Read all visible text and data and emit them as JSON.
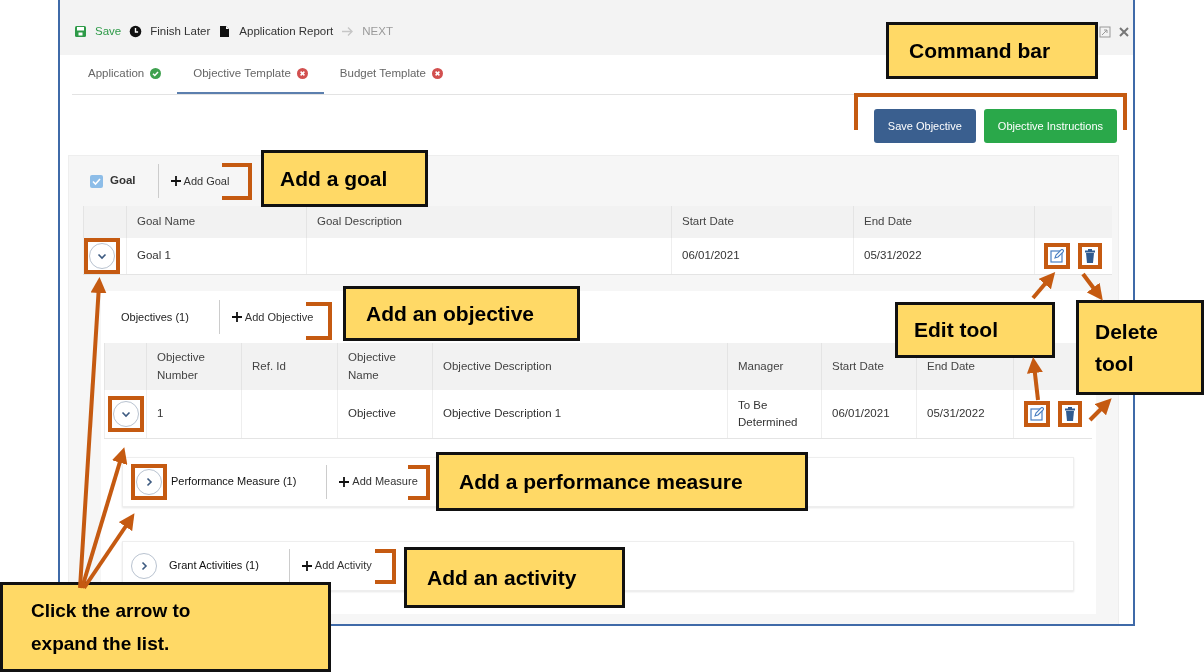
{
  "toolbar": [
    {
      "label": "Save",
      "kind": "save",
      "disabled": false
    },
    {
      "label": "Finish Later",
      "kind": "clock",
      "disabled": false
    },
    {
      "label": "Application Report",
      "kind": "file",
      "disabled": false
    },
    {
      "label": "NEXT",
      "kind": "next",
      "disabled": true
    }
  ],
  "tabs": [
    {
      "label": "Application",
      "selected": false,
      "complete": true
    },
    {
      "label": "Objective Template",
      "selected": true,
      "complete": false
    },
    {
      "label": "Budget Template",
      "selected": false,
      "complete": false
    }
  ],
  "command_bar": [
    {
      "label": "Save Objective",
      "kind": "primary"
    },
    {
      "label": "Objective Instructions",
      "kind": "success"
    }
  ],
  "goal": {
    "label": "Goal",
    "checked": true,
    "add_label": "Add Goal",
    "columns": [
      "Goal Name",
      "Goal Description",
      "Start Date",
      "End Date"
    ],
    "rows": [
      {
        "expanded": true,
        "name": "Goal 1",
        "start": "06/01/2021",
        "end": "05/31/2022"
      }
    ]
  },
  "objectives": {
    "label": "Objectives (1)",
    "add_label": "Add Objective",
    "columns": [
      "Objective Number",
      "Ref. Id",
      "Objective Name",
      "Objective Description",
      "Manager",
      "Start Date",
      "End Date"
    ],
    "rows": [
      {
        "expanded": true,
        "number": "1",
        "name": "Objective",
        "description": "Objective Description 1",
        "manager": "To Be Determined",
        "start": "06/01/2021",
        "end": "05/31/2022"
      }
    ]
  },
  "sections": [
    {
      "label": "Performance Measure (1)",
      "add_label": "Add Measure",
      "expanded": false
    },
    {
      "label": "Grant Activities (1)",
      "add_label": "Add Activity",
      "expanded": false
    }
  ],
  "callouts": [
    "Command bar",
    "Add a goal",
    "Add an objective",
    "Edit tool",
    "Delete tool",
    "Add a performance measure",
    "Add an activity",
    "Click the arrow to expand the list."
  ]
}
